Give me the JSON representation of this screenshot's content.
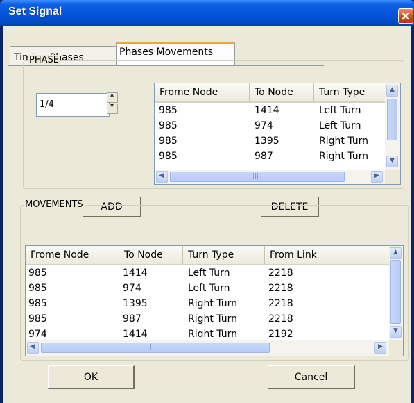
{
  "window": {
    "title": "Set Signal"
  },
  "tabs": [
    {
      "label": "Timing Phases"
    },
    {
      "label": "Phases Movements"
    }
  ],
  "phase": {
    "group_label": "PHASE",
    "spin_value": "1/4",
    "columns": [
      "Frome Node",
      "To Node",
      "Turn Type"
    ],
    "rows": [
      [
        "985",
        "1414",
        "Left Turn"
      ],
      [
        "985",
        "974",
        "Left Turn"
      ],
      [
        "985",
        "1395",
        "Right Turn"
      ],
      [
        "985",
        "987",
        "Right Turn"
      ]
    ]
  },
  "buttons": {
    "add": "ADD",
    "delete": "DELETE",
    "ok": "OK",
    "cancel": "Cancel"
  },
  "movements": {
    "group_label": "MOVEMENTS",
    "columns": [
      "Frome Node",
      "To Node",
      "Turn Type",
      "From Link"
    ],
    "rows": [
      [
        "985",
        "1414",
        "Left Turn",
        "2218"
      ],
      [
        "985",
        "974",
        "Left Turn",
        "2218"
      ],
      [
        "985",
        "1395",
        "Right Turn",
        "2218"
      ],
      [
        "985",
        "987",
        "Right Turn",
        "2218"
      ],
      [
        "974",
        "1414",
        "Right Turn",
        "2192"
      ]
    ]
  },
  "icons": {
    "close": "close-icon",
    "spin_up": "spin-up-icon",
    "spin_down": "spin-down-icon",
    "scroll_up": "scroll-up-icon",
    "scroll_down": "scroll-down-icon",
    "scroll_left": "scroll-left-icon",
    "scroll_right": "scroll-right-icon"
  }
}
